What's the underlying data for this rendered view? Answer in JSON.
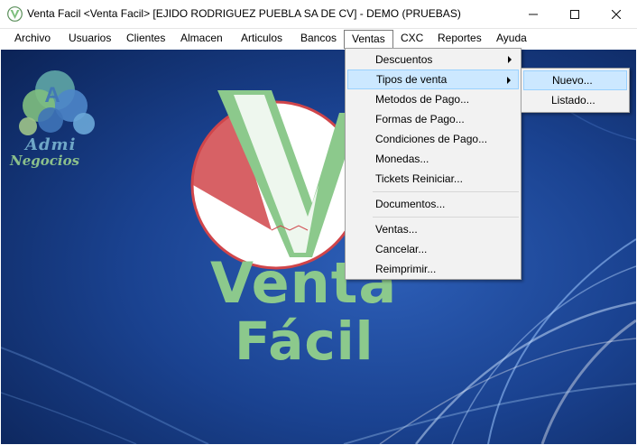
{
  "window": {
    "title": "Venta Facil <Venta Facil> [EJIDO RODRIGUEZ PUEBLA SA DE CV] - DEMO (PRUEBAS)",
    "minimize_icon": "minimize-icon",
    "maximize_icon": "maximize-icon",
    "close_icon": "close-icon"
  },
  "menubar": {
    "items": [
      {
        "label": "Archivo"
      },
      {
        "label": "Usuarios"
      },
      {
        "label": "Clientes"
      },
      {
        "label": "Almacen"
      },
      {
        "label": "Articulos"
      },
      {
        "label": "Bancos"
      },
      {
        "label": "Ventas"
      },
      {
        "label": "CXC"
      },
      {
        "label": "Reportes"
      },
      {
        "label": "Ayuda"
      }
    ],
    "open_menu": "Ventas"
  },
  "ventas_menu": {
    "items": [
      {
        "label": "Descuentos"
      },
      {
        "label": "Tipos de venta"
      },
      {
        "label": "Metodos de Pago..."
      },
      {
        "label": "Formas de Pago..."
      },
      {
        "label": "Condiciones de Pago..."
      },
      {
        "label": "Monedas..."
      },
      {
        "label": "Tickets Reiniciar..."
      },
      {
        "label": "Documentos..."
      },
      {
        "label": "Ventas..."
      },
      {
        "label": "Cancelar..."
      },
      {
        "label": "Reimprimir..."
      }
    ]
  },
  "tipos_venta_submenu": {
    "items": [
      {
        "label": "Nuevo..."
      },
      {
        "label": "Listado..."
      }
    ]
  },
  "background": {
    "corner_logo_line1": "Admi",
    "corner_logo_line2": "Negocios",
    "brand_line1": "Venta",
    "brand_line2": "Fácil"
  },
  "colors": {
    "desktop_bg": "#15357a",
    "highlight": "#cce8ff",
    "logo_green": "#8cc98c",
    "logo_red": "#d0454a"
  }
}
